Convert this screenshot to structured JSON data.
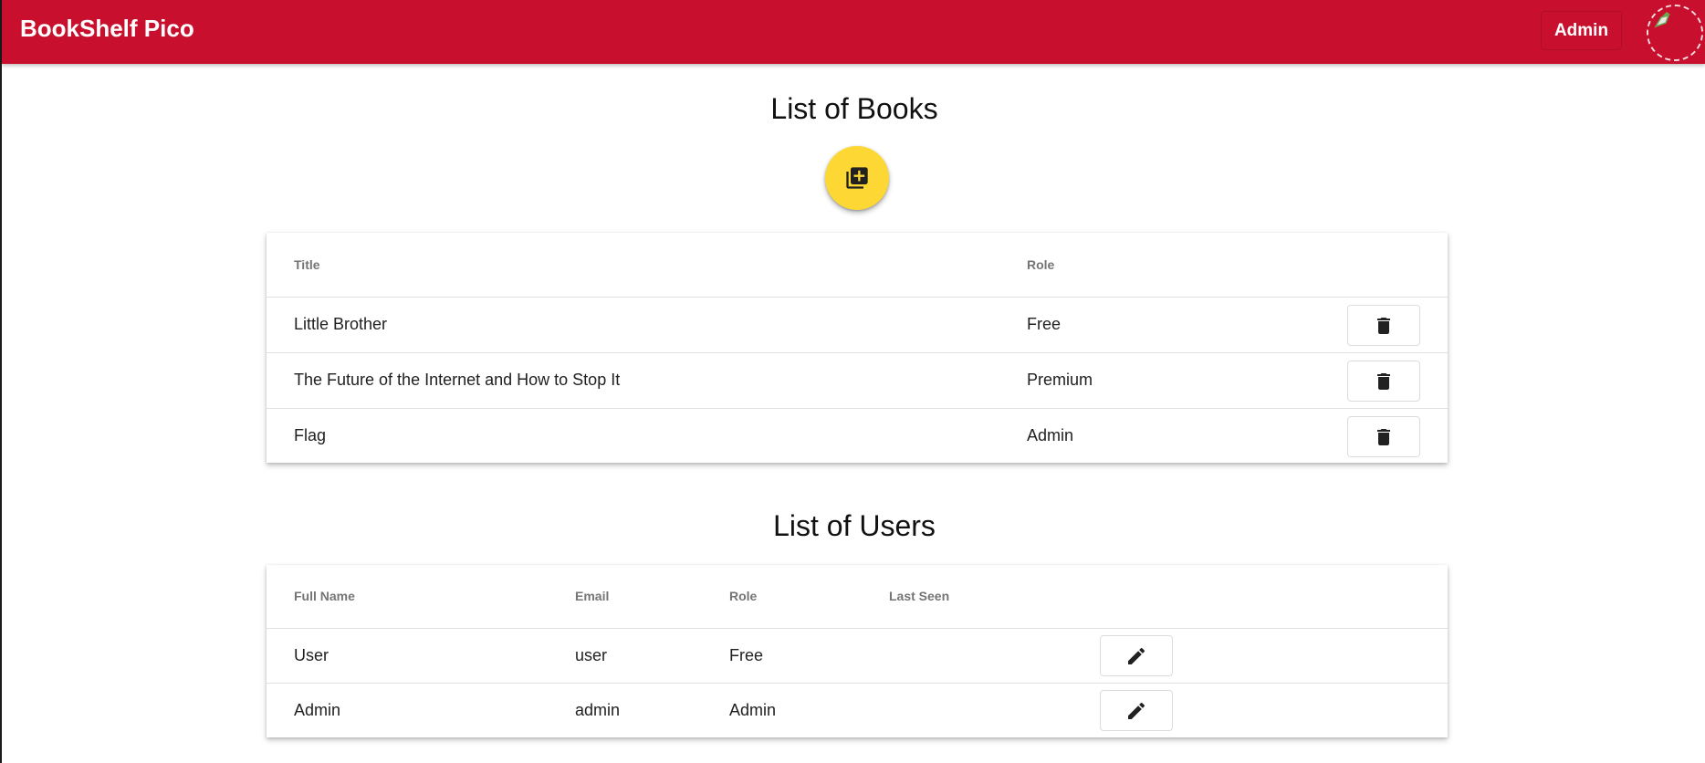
{
  "app": {
    "brand": "BookShelf Pico",
    "role_button_label": "Admin"
  },
  "books_section": {
    "title": "List of Books",
    "columns": {
      "title": "Title",
      "role": "Role"
    },
    "rows": [
      {
        "title": "Little Brother",
        "role": "Free"
      },
      {
        "title": "The Future of the Internet and How to Stop It",
        "role": "Premium"
      },
      {
        "title": "Flag",
        "role": "Admin"
      }
    ]
  },
  "users_section": {
    "title": "List of Users",
    "columns": {
      "full_name": "Full Name",
      "email": "Email",
      "role": "Role",
      "last_seen": "Last Seen"
    },
    "rows": [
      {
        "full_name": "User",
        "email": "user",
        "role": "Free",
        "last_seen": ""
      },
      {
        "full_name": "Admin",
        "email": "admin",
        "role": "Admin",
        "last_seen": ""
      }
    ]
  },
  "icons": {
    "add_book": "library-add-icon",
    "delete": "trash-icon",
    "edit": "pencil-icon",
    "avatar": "broken-image-icon"
  },
  "colors": {
    "app_bar": "#c8102e",
    "fab": "#fdd835"
  }
}
